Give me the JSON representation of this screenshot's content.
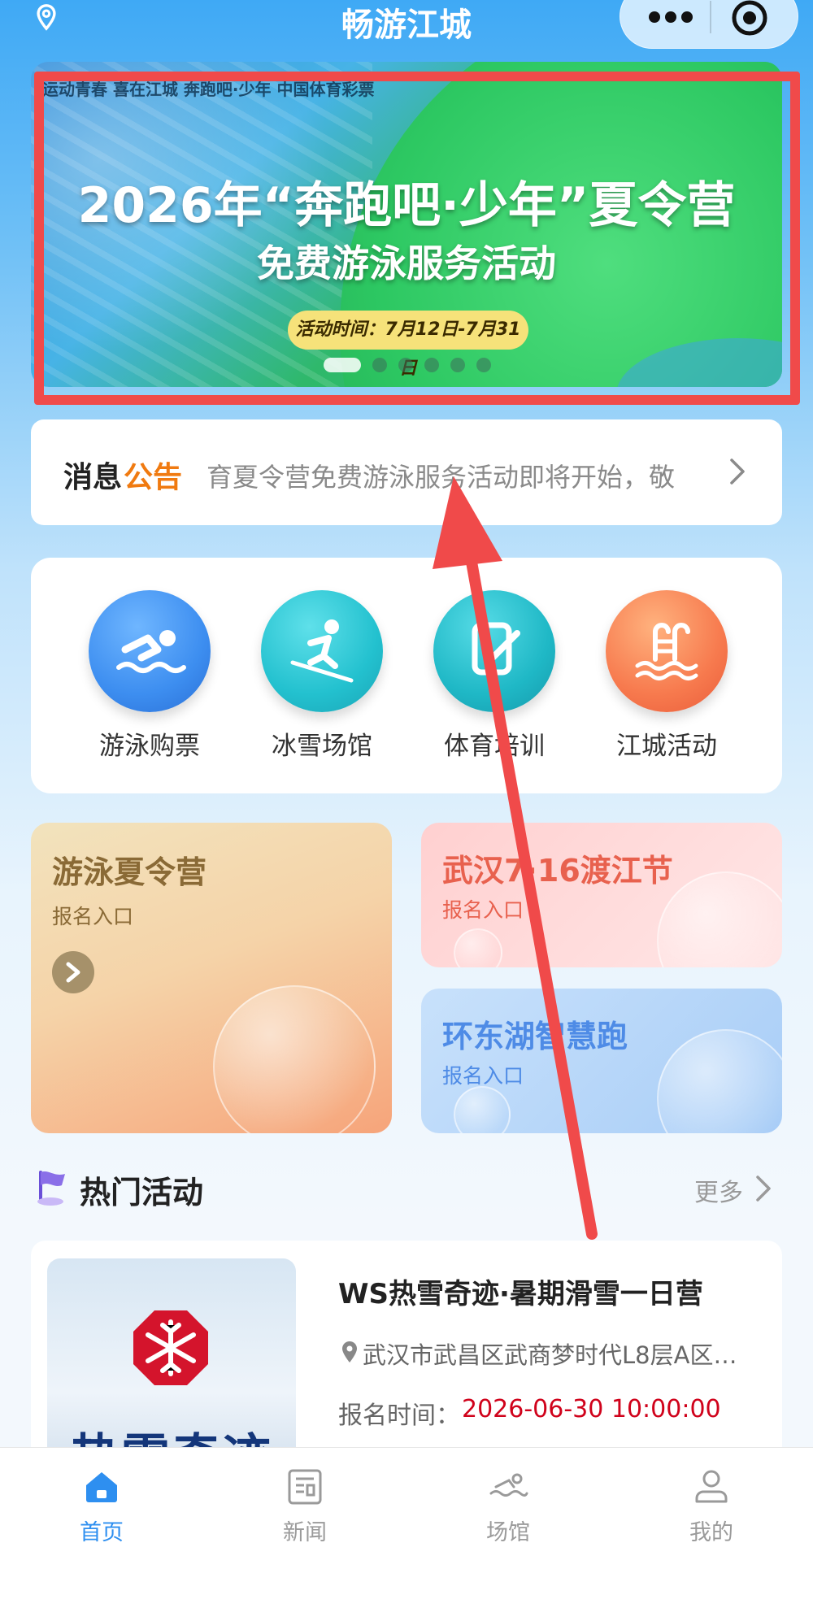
{
  "header": {
    "title": "畅游江城"
  },
  "banner": {
    "sponsors": "运动青春 喜在江城      奔跑吧·少年      中国体育彩票",
    "title": "2026年“奔跑吧·少年”夏令营",
    "subtitle": "免费游泳服务活动",
    "pill": "活动时间：7月12日-7月31日",
    "slides": 6,
    "active_slide": 1
  },
  "notice": {
    "label_part1": "消息",
    "label_part2": "公告",
    "text": "育夏令营免费游泳服务活动即将开始，敬"
  },
  "quick_entries": [
    {
      "label": "游泳购票",
      "icon": "swimmer-icon",
      "color": "#3d8ef0"
    },
    {
      "label": "冰雪场馆",
      "icon": "skier-icon",
      "color": "#23c1cf"
    },
    {
      "label": "体育培训",
      "icon": "training-icon",
      "color": "#1fb8c6"
    },
    {
      "label": "江城活动",
      "icon": "pool-icon",
      "color": "#f77a4e"
    }
  ],
  "cards": [
    {
      "title": "游泳夏令营",
      "subtitle": "报名入口",
      "title_color": "#8a6a36",
      "sub_color": "#8a6a36"
    },
    {
      "title": "武汉7·16渡江节",
      "subtitle": "报名入口",
      "title_color": "#e8614e",
      "sub_color": "#e8614e"
    },
    {
      "title": "环东湖智慧跑",
      "subtitle": "报名入口",
      "title_color": "#4e8be6",
      "sub_color": "#4e8be6"
    }
  ],
  "hot": {
    "title": "热门活动",
    "more": "更多",
    "items": [
      {
        "title": "WS热雪奇迹·暑期滑雪一日营",
        "address": "武汉市武昌区武商梦时代L8层A区…",
        "time_label": "报名时间：",
        "time": "2026-06-30 10:00:00",
        "brand": "热雪奇迹"
      }
    ]
  },
  "tabbar": [
    {
      "label": "首页",
      "active": true
    },
    {
      "label": "新闻",
      "active": false
    },
    {
      "label": "场馆",
      "active": false
    },
    {
      "label": "我的",
      "active": false
    }
  ],
  "colors": {
    "accent": "#2e8ff0",
    "highlight_box": "#f04a4a",
    "time_red": "#d0021b"
  }
}
